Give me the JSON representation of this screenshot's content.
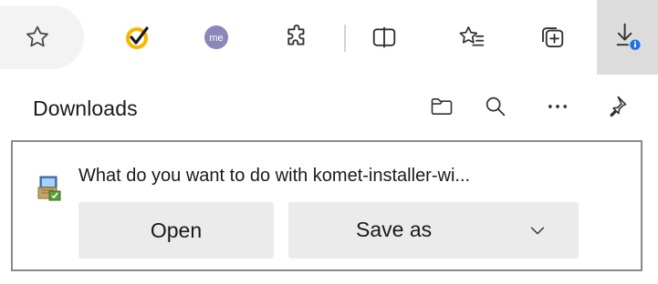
{
  "toolbar": {
    "buttons": [
      {
        "name": "favorite-star",
        "icon": "star-outline-icon"
      },
      {
        "name": "norton-extension",
        "icon": "norton-check-icon"
      },
      {
        "name": "me-extension",
        "icon": "me-circle-icon",
        "label": "me"
      },
      {
        "name": "extensions",
        "icon": "puzzle-icon"
      },
      {
        "name": "split-screen",
        "icon": "split-screen-icon"
      },
      {
        "name": "favorites",
        "icon": "favorites-list-icon"
      },
      {
        "name": "collections",
        "icon": "collections-icon"
      },
      {
        "name": "downloads",
        "icon": "download-arrow-icon",
        "active": true
      }
    ],
    "colors": {
      "norton_yellow": "#f5b800",
      "me_purple": "#8b87b8",
      "badge_blue": "#1a73e8",
      "active_bg": "#dcdcdc"
    }
  },
  "downloads_panel": {
    "title": "Downloads",
    "header_actions": [
      {
        "name": "open-folder",
        "icon": "folder-icon"
      },
      {
        "name": "search",
        "icon": "search-icon"
      },
      {
        "name": "more-options",
        "icon": "ellipsis-icon"
      },
      {
        "name": "pin",
        "icon": "pin-icon"
      }
    ],
    "item": {
      "prompt": "What do you want to do with komet-installer-wi...",
      "file_icon": "installer-icon",
      "open_label": "Open",
      "save_as_label": "Save as",
      "dropdown_icon": "chevron-down-icon"
    }
  }
}
